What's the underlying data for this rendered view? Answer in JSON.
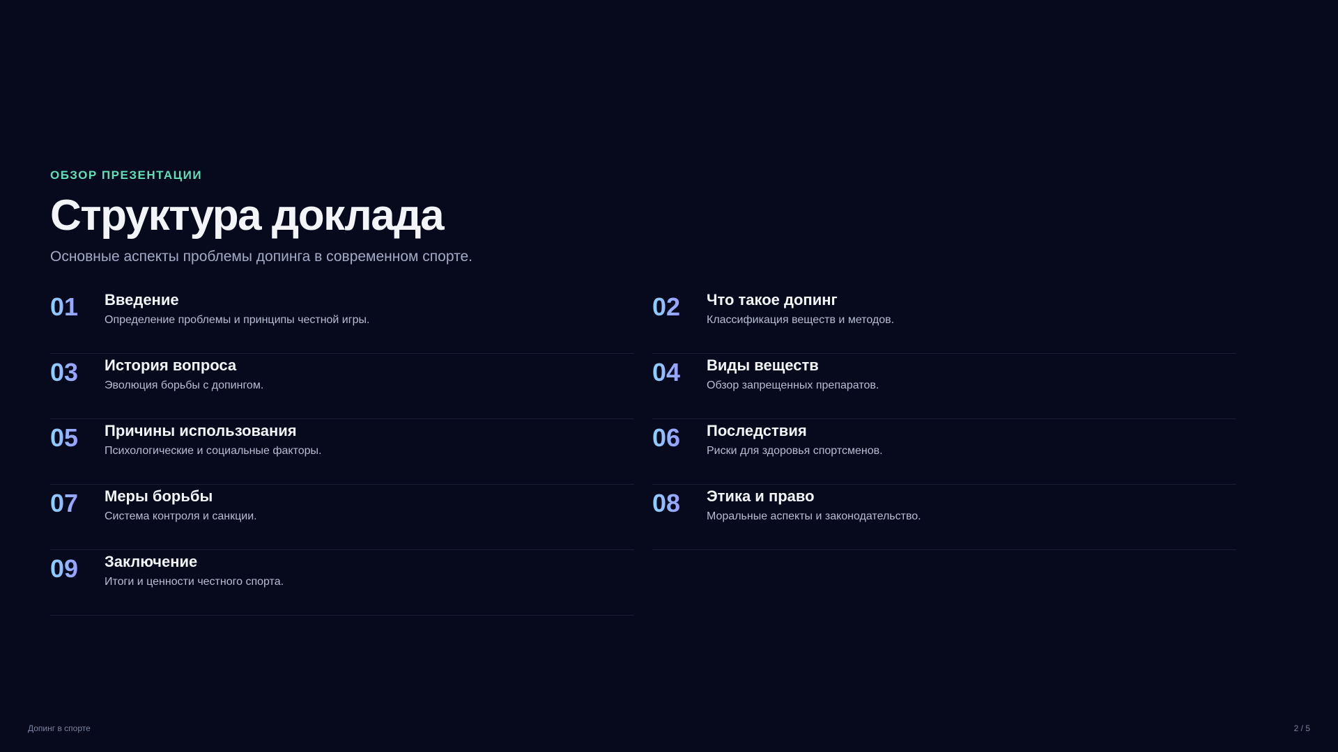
{
  "header": {
    "eyebrow": "ОБЗОР ПРЕЗЕНТАЦИИ",
    "title": "Структура доклада",
    "subtitle": "Основные аспекты проблемы допинга в современном спорте."
  },
  "agenda": [
    {
      "number": "01",
      "title": "Введение",
      "description": "Определение проблемы и принципы честной игры."
    },
    {
      "number": "02",
      "title": "Что такое допинг",
      "description": "Классификация веществ и методов."
    },
    {
      "number": "03",
      "title": "История вопроса",
      "description": "Эволюция борьбы с допингом."
    },
    {
      "number": "04",
      "title": "Виды веществ",
      "description": "Обзор запрещенных препаратов."
    },
    {
      "number": "05",
      "title": "Причины использования",
      "description": "Психологические и социальные факторы."
    },
    {
      "number": "06",
      "title": "Последствия",
      "description": "Риски для здоровья спортсменов."
    },
    {
      "number": "07",
      "title": "Меры борьбы",
      "description": "Система контроля и санкции."
    },
    {
      "number": "08",
      "title": "Этика и право",
      "description": "Моральные аспекты и законодательство."
    },
    {
      "number": "09",
      "title": "Заключение",
      "description": "Итоги и ценности честного спорта."
    }
  ],
  "footer": {
    "deck_title": "Допинг в спорте",
    "page_indicator": "2 / 5"
  },
  "colors": {
    "background": "#070a1c",
    "accent_eyebrow": "#5fe0b8",
    "number_gradient_start": "#8ed2ff",
    "number_gradient_end": "#9a9cff"
  }
}
